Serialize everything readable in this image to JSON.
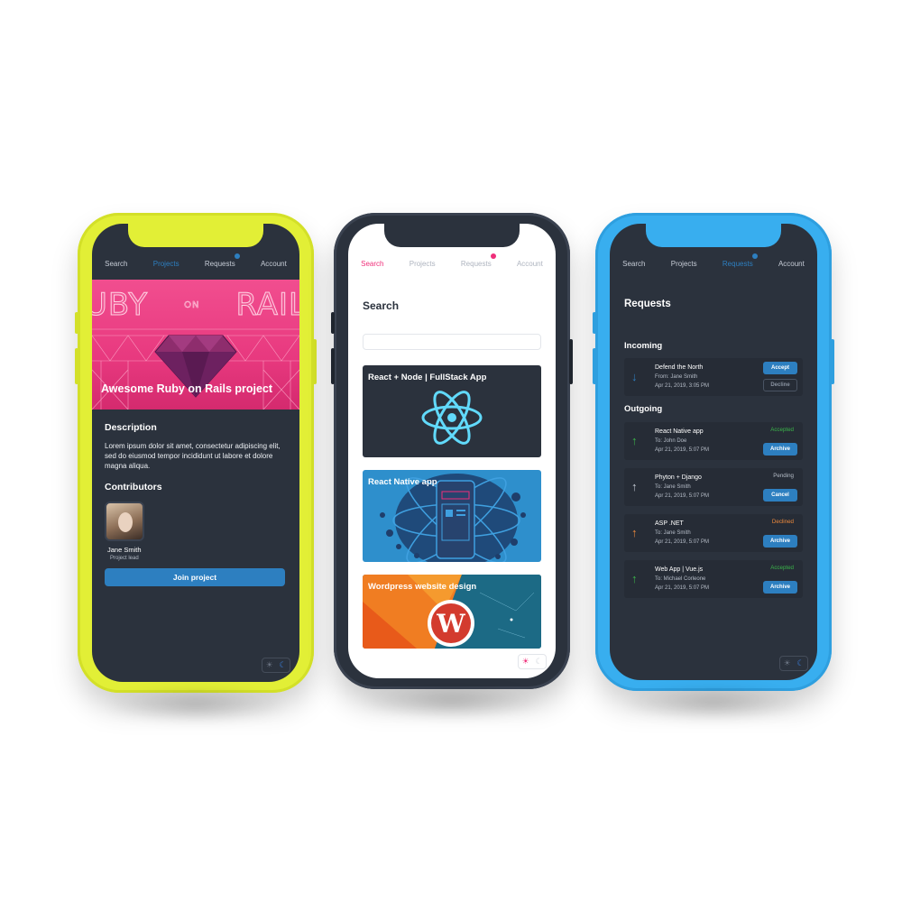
{
  "colors": {
    "accent_blue": "#2d7fc0",
    "accent_pink": "#ef2f7a",
    "screen_dark": "#2b323d",
    "phone_yellow": "#e2ef36",
    "phone_blue": "#38aeef",
    "accepted": "#3bb54a",
    "declined": "#f08a3c"
  },
  "phone1": {
    "nav": {
      "search": "Search",
      "projects": "Projects",
      "requests": "Requests",
      "account": "Account"
    },
    "hero_art_left": "UBY",
    "hero_art_mid": "ON",
    "hero_art_right": "RAIL",
    "project_title": "Awesome Ruby on Rails project",
    "description_heading": "Description",
    "description_text": "Lorem ipsum dolor sit amet, consectetur adipiscing elit, sed do eiusmod tempor incididunt ut labore et dolore magna aliqua.",
    "contributors_heading": "Contributors",
    "contributor_name": "Jane Smith",
    "contributor_role": "Project lead",
    "join_button": "Join project"
  },
  "phone2": {
    "nav": {
      "search": "Search",
      "projects": "Projects",
      "requests": "Requests",
      "account": "Account"
    },
    "title": "Search",
    "search_placeholder": "",
    "cards": [
      {
        "title": "React + Node | FullStack App"
      },
      {
        "title": "React Native app"
      },
      {
        "title": "Wordpress website design"
      }
    ]
  },
  "phone3": {
    "nav": {
      "search": "Search",
      "projects": "Projects",
      "requests": "Requests",
      "account": "Account"
    },
    "title": "Requests",
    "incoming_heading": "Incoming",
    "outgoing_heading": "Outgoing",
    "incoming": [
      {
        "name": "Defend the North",
        "who": "From: Jane Smith",
        "date": "Apr 21, 2019, 3:05 PM",
        "accept": "Accept",
        "decline": "Decline"
      }
    ],
    "outgoing": [
      {
        "name": "React Native app",
        "who": "To: John Doe",
        "date": "Apr 21, 2019, 5:07 PM",
        "status": "Accepted",
        "action": "Archive"
      },
      {
        "name": "Phyton + Django",
        "who": "To: Jane Smith",
        "date": "Apr 21, 2019, 5:07 PM",
        "status": "Pending",
        "action": "Cancel"
      },
      {
        "name": "ASP .NET",
        "who": "To: Jane Smith",
        "date": "Apr 21, 2019, 5:07 PM",
        "status": "Declined",
        "action": "Archive"
      },
      {
        "name": "Web App | Vue.js",
        "who": "To: Michael Corleone",
        "date": "Apr 21, 2019, 5:07 PM",
        "status": "Accepted",
        "action": "Archive"
      }
    ]
  }
}
